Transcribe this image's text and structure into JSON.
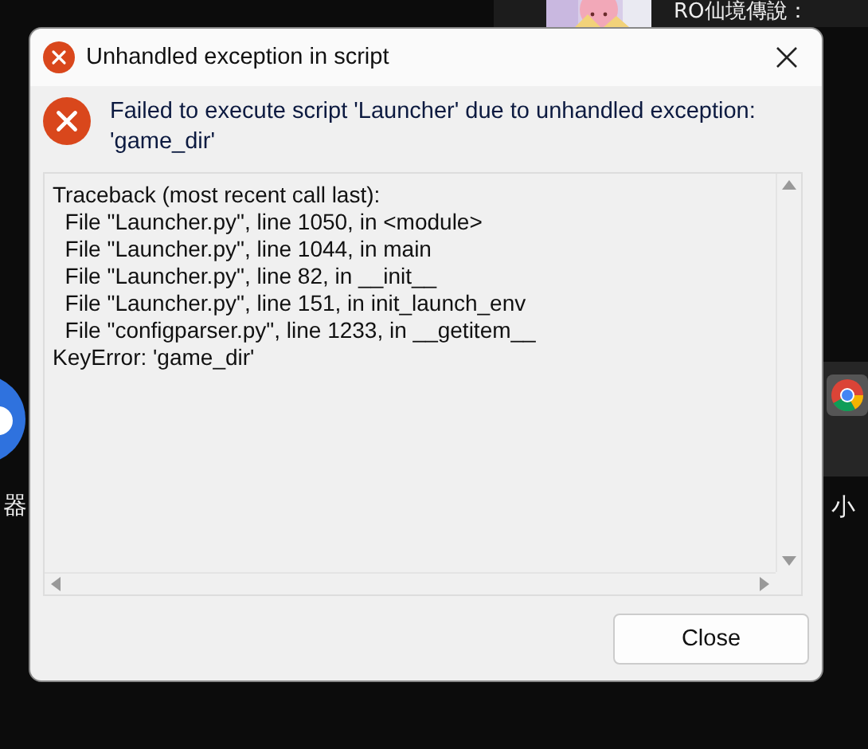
{
  "desktop": {
    "top_tile": {
      "label": "RO仙境傳說："
    },
    "left_shortcut": {
      "label": "器"
    },
    "right_shortcut": {
      "label": "小"
    }
  },
  "dialog": {
    "title": "Unhandled exception in script",
    "message": "Failed to execute script 'Launcher' due to unhandled exception: 'game_dir'",
    "traceback": [
      "Traceback (most recent call last):",
      "  File \"Launcher.py\", line 1050, in <module>",
      "  File \"Launcher.py\", line 1044, in main",
      "  File \"Launcher.py\", line 82, in __init__",
      "  File \"Launcher.py\", line 151, in init_launch_env",
      "  File \"configparser.py\", line 1233, in __getitem__",
      "KeyError: 'game_dir'"
    ],
    "buttons": [
      "Close"
    ]
  }
}
